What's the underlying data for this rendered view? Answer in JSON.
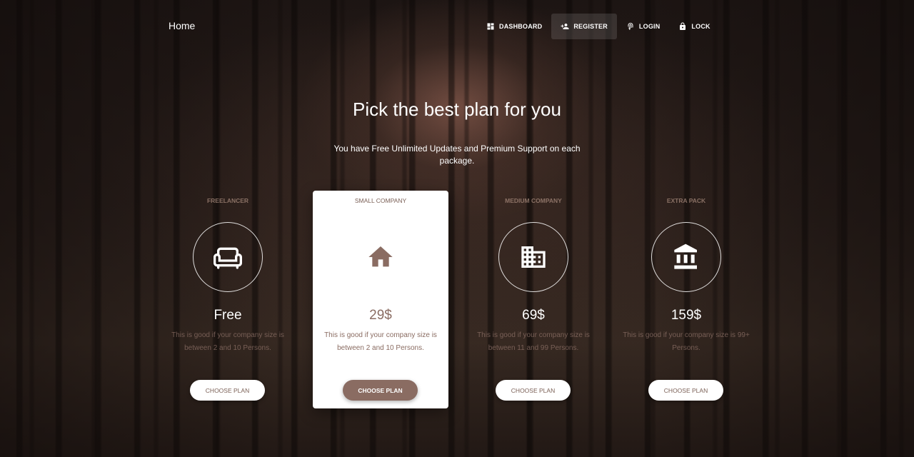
{
  "navbar": {
    "brand": "Home",
    "items": [
      {
        "label": "DASHBOARD",
        "icon": "dashboard-icon",
        "active": false
      },
      {
        "label": "REGISTER",
        "icon": "person-add-icon",
        "active": true
      },
      {
        "label": "LOGIN",
        "icon": "fingerprint-icon",
        "active": false
      },
      {
        "label": "LOCK",
        "icon": "lock-icon",
        "active": false
      }
    ]
  },
  "header": {
    "title": "Pick the best plan for you",
    "subtitle": "You have Free Unlimited Updates and Premium Support on each package."
  },
  "plans": [
    {
      "category": "FREELANCER",
      "icon": "sofa-icon",
      "price": "Free",
      "description": "This is good if your company size is between 2 and 10 Persons.",
      "button": "CHOOSE PLAN",
      "featured": false
    },
    {
      "category": "SMALL COMPANY",
      "icon": "home-icon",
      "price": "29$",
      "description": "This is good if your company size is between 2 and 10 Persons.",
      "button": "CHOOSE PLAN",
      "featured": true
    },
    {
      "category": "MEDIUM COMPANY",
      "icon": "business-icon",
      "price": "69$",
      "description": "This is good if your company size is between 11 and 99 Persons.",
      "button": "CHOOSE PLAN",
      "featured": false
    },
    {
      "category": "EXTRA PACK",
      "icon": "bank-icon",
      "price": "159$",
      "description": "This is good if your company size is 99+ Persons.",
      "button": "CHOOSE PLAN",
      "featured": false
    }
  ],
  "colors": {
    "accent": "#8a6c62",
    "background": "#241a17",
    "card": "#ffffff"
  }
}
